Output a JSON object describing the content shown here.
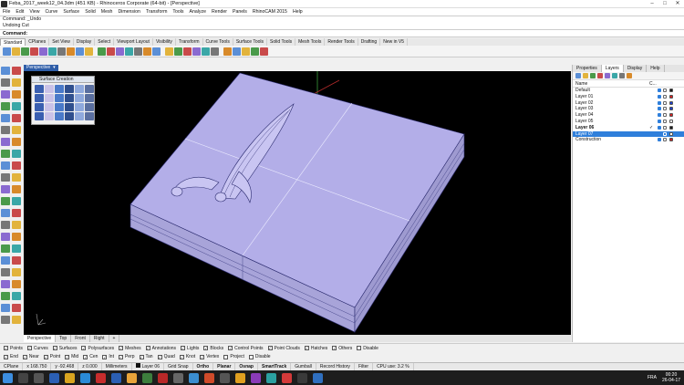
{
  "window": {
    "title": "Feba_2017_week12_04.3dm (451 KB) - Rhinoceros Corporate (64-bit) - [Perspective]",
    "controls": [
      "–",
      "□",
      "✕"
    ]
  },
  "menu": [
    "File",
    "Edit",
    "View",
    "Curve",
    "Surface",
    "Solid",
    "Mesh",
    "Dimension",
    "Transform",
    "Tools",
    "Analyze",
    "Render",
    "Panels",
    "RhinoCAM 2015",
    "Help"
  ],
  "command_history": [
    "Command: _Undo",
    "Undoing Cut"
  ],
  "command_line": "Command:",
  "toolbar_tabs": [
    "Standard",
    "CPlanes",
    "Set View",
    "Display",
    "Select",
    "Viewport Layout",
    "Visibility",
    "Transform",
    "Curve Tools",
    "Surface Tools",
    "Solid Tools",
    "Mesh Tools",
    "Render Tools",
    "Drafting",
    "New in V5"
  ],
  "toolbar_icons": [
    "new-icon",
    "open-icon",
    "save-icon",
    "print-icon",
    "import-icon",
    "cut-icon",
    "copy-icon",
    "paste-icon",
    "undo-icon",
    "redo-icon",
    "pan-icon",
    "rotate-view-icon",
    "zoom-icon",
    "zoom-window-icon",
    "zoom-extents-icon",
    "zoom-selected-icon",
    "grid-icon",
    "layer-icon",
    "select-all-icon",
    "box-icon",
    "toggle-icon",
    "properties-icon",
    "lock-icon",
    "light-icon",
    "render-icon",
    "hide-icon",
    "options-icon",
    "help-icon"
  ],
  "viewport": {
    "label": "Perspective",
    "tabs": [
      "Perspective",
      "Top",
      "Front",
      "Right",
      "+"
    ]
  },
  "surface_panel": {
    "title": "Surface Creation"
  },
  "right_panel": {
    "tabs": [
      "Properties",
      "Layers",
      "Display",
      "Help"
    ],
    "active_tab": "Layers",
    "header_name": "Name",
    "header_c": "C...",
    "layers": [
      {
        "name": "Default",
        "color": "#1a1a1a",
        "current": false,
        "selected": false
      },
      {
        "name": "Layer 01",
        "color": "#d62020",
        "current": false,
        "selected": false
      },
      {
        "name": "Layer 02",
        "color": "#1c3fcf",
        "current": false,
        "selected": false
      },
      {
        "name": "Layer 03",
        "color": "#1c3fcf",
        "current": false,
        "selected": false
      },
      {
        "name": "Layer 04",
        "color": "#d62020",
        "current": false,
        "selected": false
      },
      {
        "name": "Layer 05",
        "color": "#ffffff",
        "current": false,
        "selected": false
      },
      {
        "name": "Layer 06",
        "color": "#1a1a1a",
        "current": true,
        "selected": false
      },
      {
        "name": "Layer 07",
        "color": "#ffffff",
        "current": false,
        "selected": true
      },
      {
        "name": "Construction",
        "color": "#d62020",
        "current": false,
        "selected": false
      }
    ]
  },
  "osnap": [
    {
      "label": "Points",
      "checked": true
    },
    {
      "label": "Curves",
      "checked": true
    },
    {
      "label": "Surfaces",
      "checked": true
    },
    {
      "label": "Polysurfaces",
      "checked": true
    },
    {
      "label": "Meshes",
      "checked": true
    },
    {
      "label": "Annotations",
      "checked": true
    },
    {
      "label": "Lights",
      "checked": true
    },
    {
      "label": "Blocks",
      "checked": true
    },
    {
      "label": "Control Points",
      "checked": true
    },
    {
      "label": "Point Clouds",
      "checked": true
    },
    {
      "label": "Hatches",
      "checked": true
    },
    {
      "label": "Others",
      "checked": true
    },
    {
      "label": "Disable",
      "checked": false
    }
  ],
  "osnap2": [
    {
      "label": "End",
      "checked": true
    },
    {
      "label": "Near",
      "checked": true
    },
    {
      "label": "Point",
      "checked": true
    },
    {
      "label": "Mid",
      "checked": true
    },
    {
      "label": "Cen",
      "checked": true
    },
    {
      "label": "Int",
      "checked": true
    },
    {
      "label": "Perp",
      "checked": true
    },
    {
      "label": "Tan",
      "checked": true
    },
    {
      "label": "Quad",
      "checked": true
    },
    {
      "label": "Knot",
      "checked": true
    },
    {
      "label": "Vertex",
      "checked": true
    },
    {
      "label": "Project",
      "checked": false
    },
    {
      "label": "Disable",
      "checked": false
    }
  ],
  "status": {
    "cplane": "CPlane",
    "x": "x 168.750",
    "y": "y -92.468",
    "z": "z 0.000",
    "units": "Millimeters",
    "layer": "Layer 06",
    "toggles": [
      "Grid Snap",
      "Ortho",
      "Planar",
      "Osnap",
      "SmartTrack",
      "Gumball",
      "Record History",
      "Filter"
    ],
    "bold_toggles": [
      "Ortho",
      "Planar",
      "Osnap",
      "SmartTrack"
    ],
    "cpu": "CPU use: 3.2 %"
  },
  "taskbar": {
    "lang": "FRA",
    "time": "00:20",
    "date": "26-04-17"
  },
  "colors": {
    "model": "#b3aee8",
    "model_edge": "#2a2a6e",
    "accent": "#2f5ea8"
  }
}
